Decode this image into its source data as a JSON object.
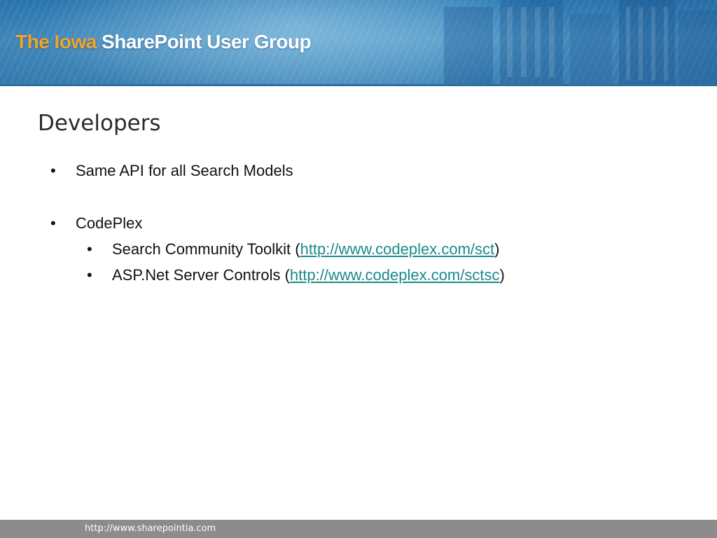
{
  "header": {
    "logo_part1": "The Iowa",
    "logo_part2": "SharePoint User Group"
  },
  "slide": {
    "title": "Developers",
    "bullets": [
      {
        "text": "Same API for all Search Models"
      },
      {
        "text": "CodePlex",
        "children": [
          {
            "prefix": "Search Community Toolkit (",
            "link": "http://www.codeplex.com/sct",
            "suffix": ")"
          },
          {
            "prefix": "ASP.Net Server Controls (",
            "link": "http://www.codeplex.com/sctsc",
            "suffix": ")"
          }
        ]
      }
    ],
    "bullet_symbol": "•"
  },
  "footer": {
    "url": "http://www.sharepointia.com"
  },
  "colors": {
    "logo_orange": "#f2a428",
    "link_teal": "#1c8a8a",
    "footer_gray": "#8c8c8c"
  }
}
